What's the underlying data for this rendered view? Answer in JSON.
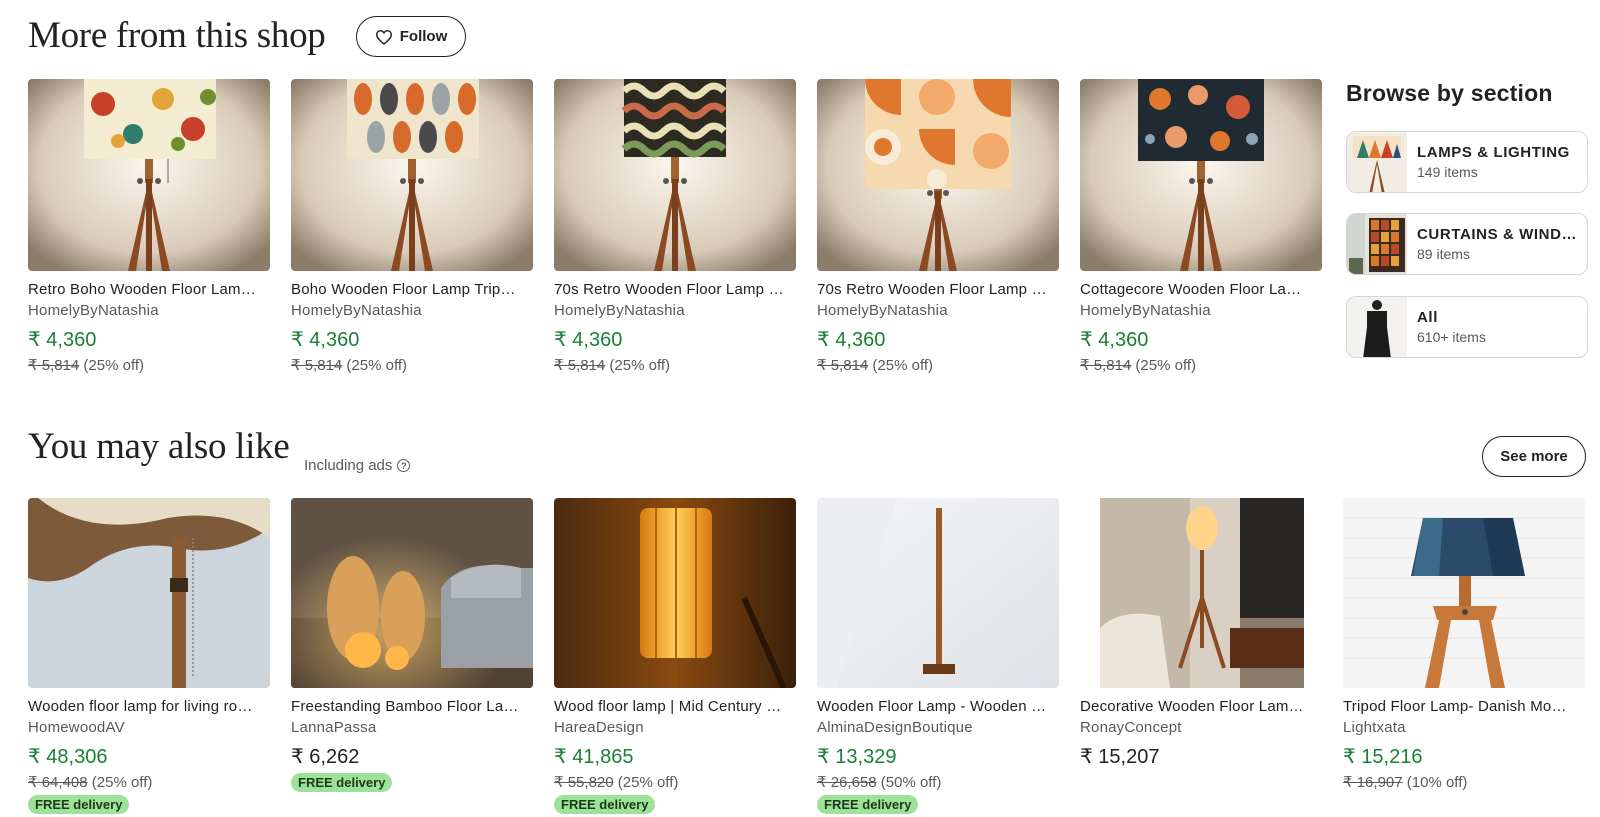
{
  "shop_section": {
    "title": "More from this shop",
    "follow_label": "Follow",
    "items": [
      {
        "title": "Retro Boho Wooden Floor Lam…",
        "shop": "HomelyByNatashia",
        "price": "₹ 4,360",
        "original": "₹ 5,814",
        "discount": "(25% off)"
      },
      {
        "title": "Boho Wooden Floor Lamp Trip…",
        "shop": "HomelyByNatashia",
        "price": "₹ 4,360",
        "original": "₹ 5,814",
        "discount": "(25% off)"
      },
      {
        "title": "70s Retro Wooden Floor Lamp …",
        "shop": "HomelyByNatashia",
        "price": "₹ 4,360",
        "original": "₹ 5,814",
        "discount": "(25% off)"
      },
      {
        "title": "70s Retro Wooden Floor Lamp …",
        "shop": "HomelyByNatashia",
        "price": "₹ 4,360",
        "original": "₹ 5,814",
        "discount": "(25% off)"
      },
      {
        "title": "Cottagecore Wooden Floor La…",
        "shop": "HomelyByNatashia",
        "price": "₹ 4,360",
        "original": "₹ 5,814",
        "discount": "(25% off)"
      }
    ]
  },
  "browse": {
    "title": "Browse by section",
    "sections": [
      {
        "name": "LAMPS & LIGHTING",
        "count": "149 items"
      },
      {
        "name": "CURTAINS & WIND…",
        "count": "89 items"
      },
      {
        "name": "All",
        "count": "610+ items"
      }
    ]
  },
  "also_like": {
    "title": "You may also like",
    "ads_label": "Including ads",
    "help_symbol": "?",
    "see_more_label": "See more",
    "free_delivery_label": "FREE delivery",
    "items": [
      {
        "title": "Wooden floor lamp for living ro…",
        "shop": "HomewoodAV",
        "price": "₹ 48,306",
        "original": "₹ 64,408",
        "discount": "(25% off)",
        "free_delivery": true
      },
      {
        "title": "Freestanding Bamboo Floor La…",
        "shop": "LannaPassa",
        "price": "₹ 6,262",
        "original": "",
        "discount": "",
        "free_delivery": true
      },
      {
        "title": "Wood floor lamp | Mid Century …",
        "shop": "HareaDesign",
        "price": "₹ 41,865",
        "original": "₹ 55,820",
        "discount": "(25% off)",
        "free_delivery": true
      },
      {
        "title": "Wooden Floor Lamp - Wooden …",
        "shop": "AlminaDesignBoutique",
        "price": "₹ 13,329",
        "original": "₹ 26,658",
        "discount": "(50% off)",
        "free_delivery": true
      },
      {
        "title": "Decorative Wooden Floor Lam…",
        "shop": "RonayConcept",
        "price": "₹ 15,207",
        "original": "",
        "discount": "",
        "free_delivery": false
      },
      {
        "title": "Tripod Floor Lamp- Danish Mo…",
        "shop": "Lightxata",
        "price": "₹ 15,216",
        "original": "₹ 16,907",
        "discount": "(10% off)",
        "free_delivery": false
      }
    ]
  },
  "colors": {
    "sale_price": "#1a7f37",
    "free_badge": "#9ee29a",
    "text": "#222222",
    "muted": "#595959"
  },
  "icons": {
    "follow": "heart-icon",
    "help": "question-circle-icon"
  }
}
